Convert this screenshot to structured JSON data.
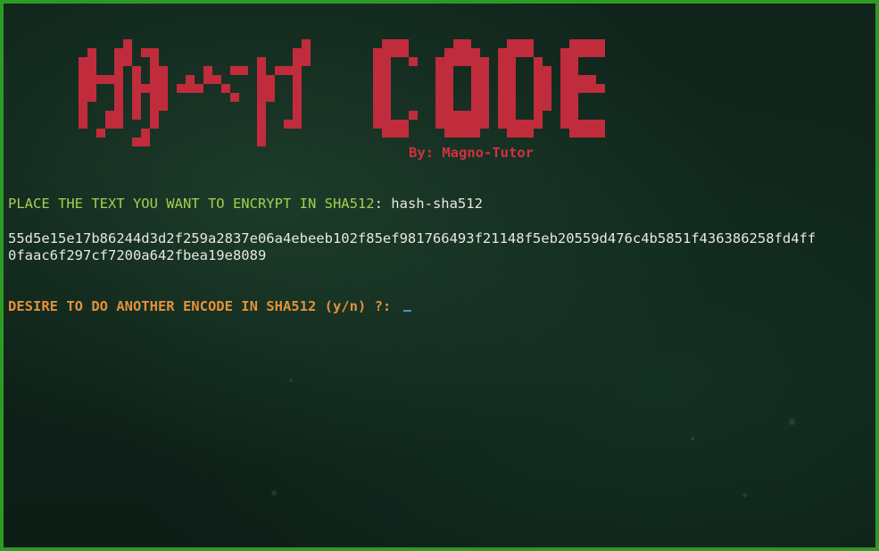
{
  "banner": {
    "logo_text": "HASH CODE",
    "byline": "By: Magno-Tutor"
  },
  "session": {
    "prompt_label": "PLACE THE TEXT YOU WANT TO ENCRYPT IN SHA512",
    "prompt_separator": ": ",
    "input_value": "hash-sha512",
    "hash_line_1": "55d5e15e17b86244d3d2f259a2837e06a4ebeeb102f85ef981766493f21148f5eb20559d476c4b5851f436386258fd4ff",
    "hash_line_2": "0faac6f297cf7200a642fbea19e8089",
    "question": "DESIRE TO DO ANOTHER ENCODE IN SHA512 (y/n) ?: "
  },
  "colors": {
    "border": "#2f9a23",
    "logo": "#c02c3c",
    "byline": "#d2303e",
    "prompt_label": "#a6cf4c",
    "text": "#e8e8e0",
    "question": "#e2913a",
    "cursor": "#4f8ad6"
  }
}
